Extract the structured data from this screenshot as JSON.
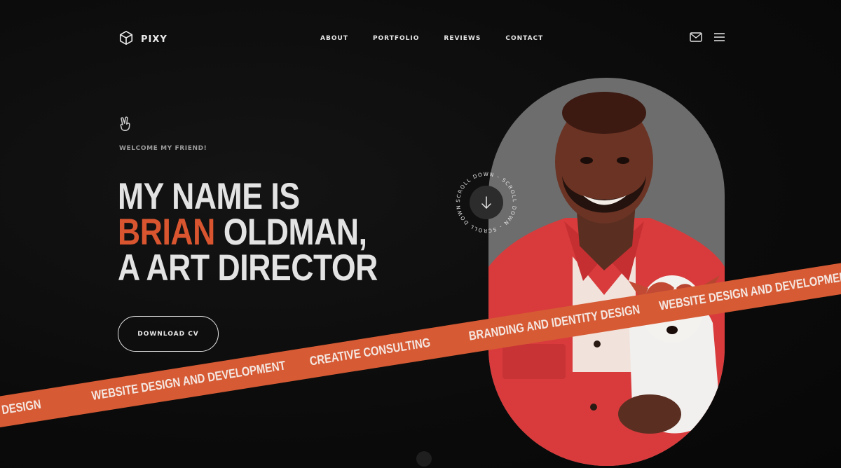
{
  "brand": {
    "name": "PIXY",
    "logo_icon": "cube-icon"
  },
  "nav": {
    "items": [
      {
        "label": "ABOUT"
      },
      {
        "label": "PORTFOLIO"
      },
      {
        "label": "REVIEWS"
      },
      {
        "label": "CONTACT"
      }
    ],
    "mail_icon": "mail-icon",
    "menu_icon": "hamburger-menu-icon"
  },
  "hero": {
    "greeting_icon": "peace-hand-icon",
    "welcome": "WELCOME MY FRIEND!",
    "line1": "MY NAME IS",
    "first_name": "BRIAN",
    "last_name": " OLDMAN,",
    "line3": "A ART DIRECTOR",
    "cta_label": "DOWNLOAD CV"
  },
  "scroll_badge": {
    "text": "SCROLL DOWN - SCROLL DOWN - SCROLL DOWN - ",
    "icon": "arrow-down-icon"
  },
  "ribbon": {
    "items": [
      "DESIGN",
      "WEBSITE DESIGN AND DEVELOPMENT",
      "CREATIVE CONSULTING",
      "BRANDING AND IDENTITY DESIGN",
      "WEBSITE DESIGN AND DEVELOPMENT"
    ]
  },
  "colors": {
    "accent": "#d9552f",
    "background": "#0b0b0b",
    "ribbon": "#d65a34",
    "photo_bg": "#6d6d6d"
  }
}
